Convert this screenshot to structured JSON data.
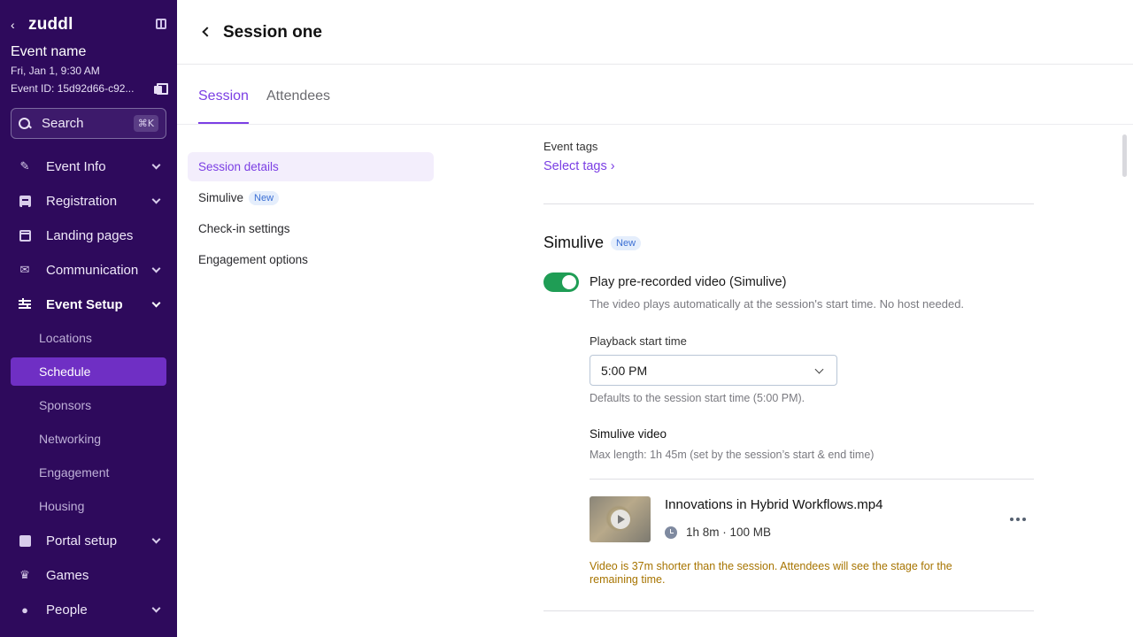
{
  "sidebar": {
    "brand": "zuddl",
    "event_name": "Event name",
    "event_date": "Fri, Jan 1, 9:30 AM",
    "event_id": "Event ID: 15d92d66-c92...",
    "search": {
      "label": "Search",
      "shortcut": "⌘K"
    },
    "items": [
      {
        "label": "Event Info",
        "icon": "wand-icon"
      },
      {
        "label": "Registration",
        "icon": "document-icon"
      },
      {
        "label": "Landing pages",
        "icon": "browser-icon"
      },
      {
        "label": "Communication",
        "icon": "mail-icon"
      },
      {
        "label": "Event Setup",
        "icon": "sliders-icon"
      },
      {
        "label": "Portal setup",
        "icon": "portal-icon"
      },
      {
        "label": "Games",
        "icon": "crown-icon"
      },
      {
        "label": "People",
        "icon": "people-icon"
      }
    ],
    "sub_items": [
      "Locations",
      "Schedule",
      "Sponsors",
      "Networking",
      "Engagement",
      "Housing"
    ],
    "selected_sub_item": "Schedule"
  },
  "header": {
    "title": "Session one"
  },
  "tabs": [
    {
      "label": "Session",
      "active": true
    },
    {
      "label": "Attendees",
      "active": false
    }
  ],
  "subnav": {
    "items": [
      "Session details",
      "Simulive",
      "Check-in settings",
      "Engagement options"
    ],
    "new_badge": "New"
  },
  "content": {
    "event_tags_label": "Event tags",
    "select_tags_link": "Select tags ›",
    "simulive_title": "Simulive",
    "simulive_badge": "New",
    "toggle_label": "Play pre-recorded video (Simulive)",
    "toggle_on": true,
    "toggle_description": "The video plays automatically at the session's start time. No host needed.",
    "playback_label": "Playback start time",
    "playback_value": "5:00 PM",
    "playback_hint": "Defaults to the session start time (5:00 PM).",
    "video_section_title": "Simulive video",
    "video_section_hint": "Max length: 1h 45m (set by the session’s start & end time)",
    "video": {
      "filename": "Innovations in Hybrid Workflows.mp4",
      "meta": "1h 8m · 100 MB"
    },
    "warning": "Video is 37m shorter than the session. Attendees will see the stage for the remaining time.",
    "warning_color": "#a77400",
    "accent_color": "#7b3fe4",
    "toggle_color": "#1f9d55"
  }
}
